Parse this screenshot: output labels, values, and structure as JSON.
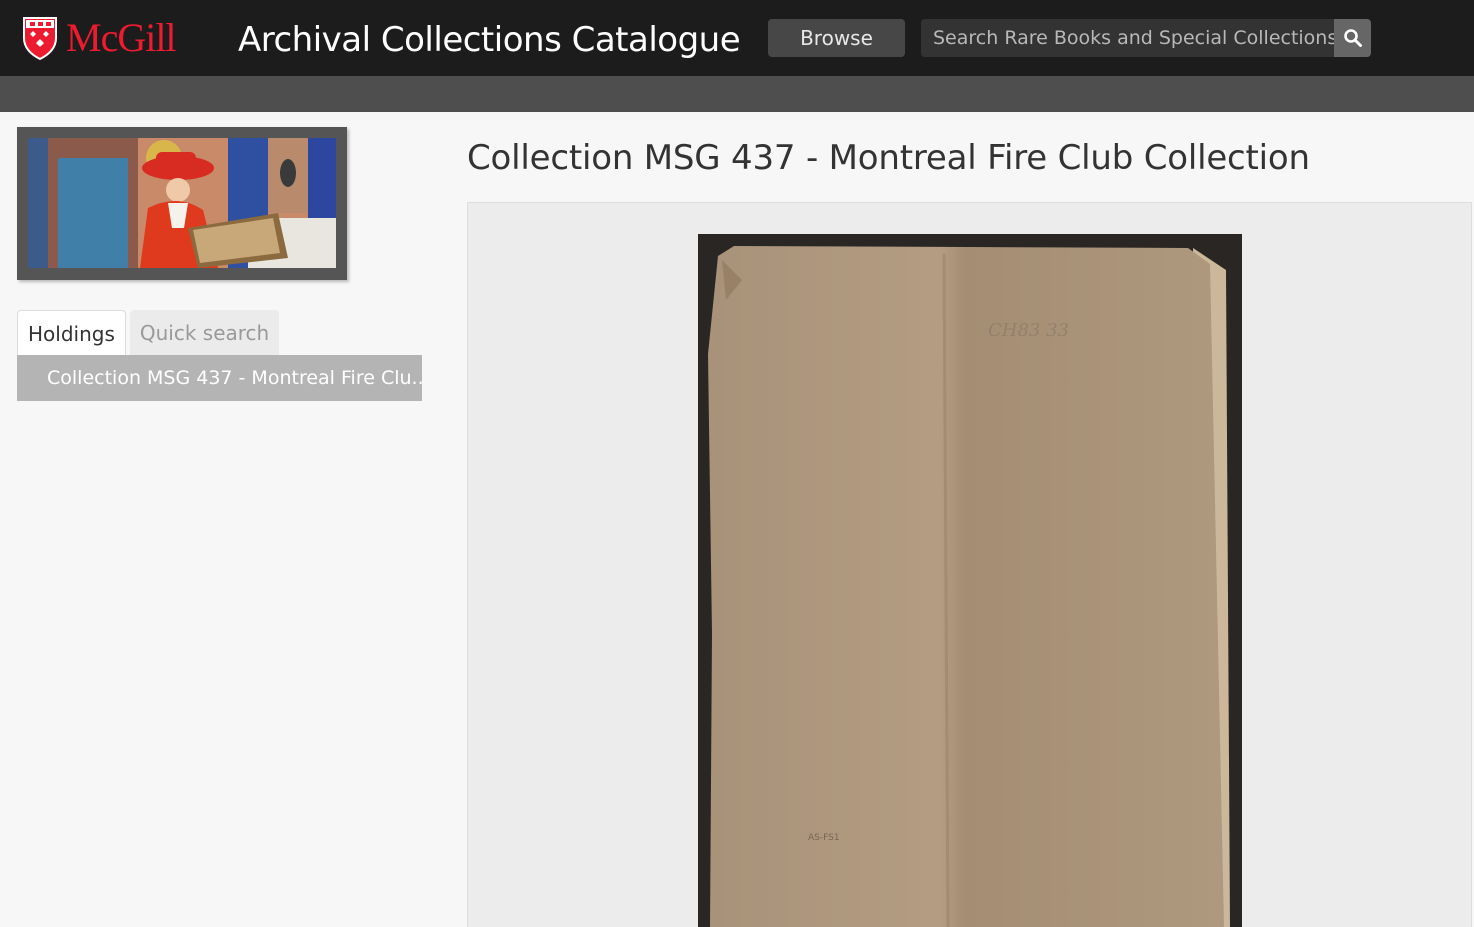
{
  "header": {
    "logo_text": "McGill",
    "site_title": "Archival Collections Catalogue",
    "browse_label": "Browse",
    "search_placeholder": "Search Rare Books and Special Collections",
    "search_icon": "magnifier-icon"
  },
  "sidebar": {
    "tabs": [
      {
        "label": "Holdings",
        "active": true
      },
      {
        "label": "Quick search",
        "active": false
      }
    ],
    "tree_item": "Collection MSG 437 - Montreal Fire Clu..."
  },
  "main": {
    "title": "Collection MSG 437 - Montreal Fire Club Collection"
  },
  "colors": {
    "header_bg": "#1c1c1c",
    "subbar_bg": "#4e4e4e",
    "logo_red": "#ed1b2f",
    "tree_item_bg": "#b4b4b4"
  }
}
